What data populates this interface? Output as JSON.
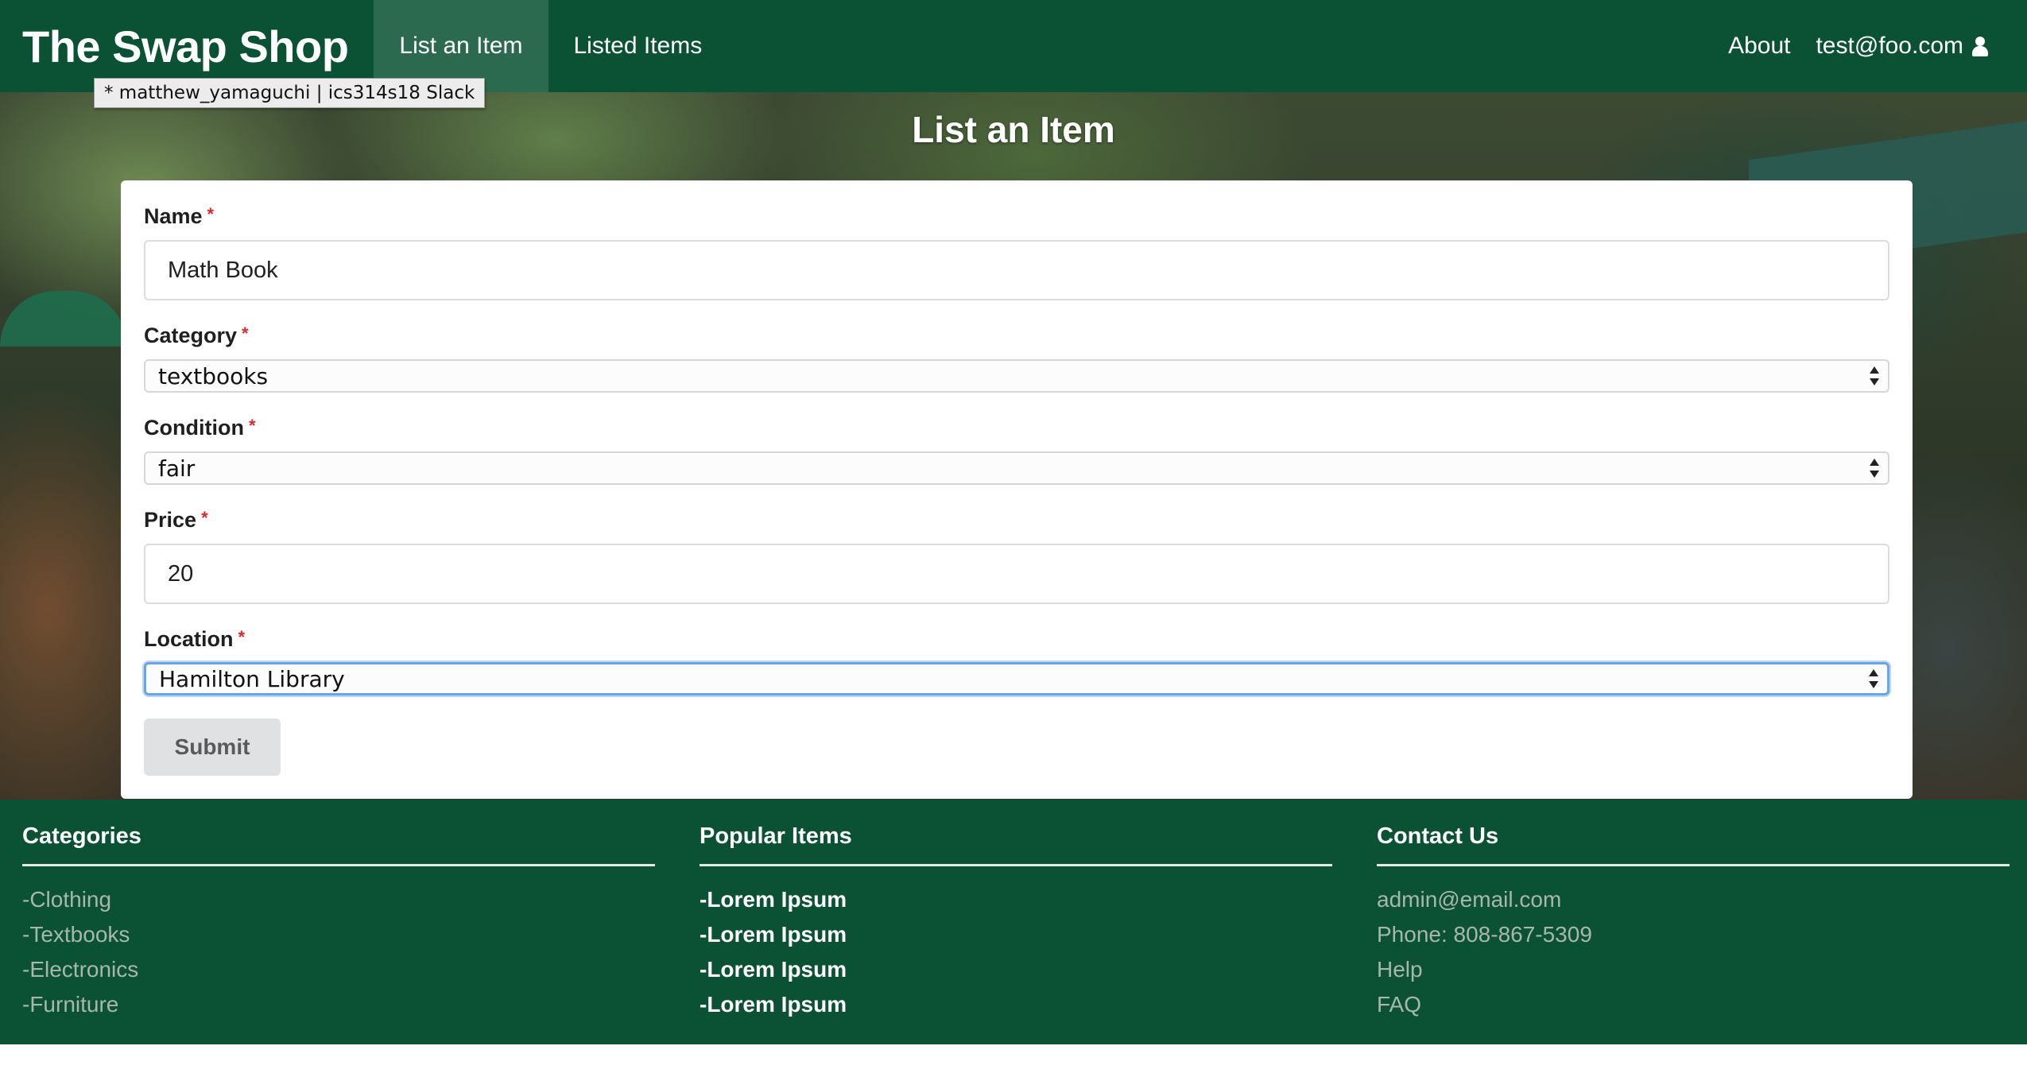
{
  "navbar": {
    "brand": "The Swap Shop",
    "items": [
      {
        "label": "List an Item",
        "active": true
      },
      {
        "label": "Listed Items",
        "active": false
      }
    ],
    "right": {
      "about": "About",
      "user": "test@foo.com",
      "user_icon": "user-icon"
    }
  },
  "tooltip": {
    "text": "* matthew_yamaguchi | ics314s18 Slack"
  },
  "page": {
    "title": "List an Item"
  },
  "form": {
    "required_marker": "*",
    "name": {
      "label": "Name",
      "value": "Math Book"
    },
    "category": {
      "label": "Category",
      "value": "textbooks"
    },
    "condition": {
      "label": "Condition",
      "value": "fair"
    },
    "price": {
      "label": "Price",
      "value": "20"
    },
    "location": {
      "label": "Location",
      "value": "Hamilton Library"
    },
    "submit_label": "Submit"
  },
  "footer": {
    "categories": {
      "heading": "Categories",
      "items": [
        "-Clothing",
        "-Textbooks",
        "-Electronics",
        "-Furniture"
      ]
    },
    "popular": {
      "heading": "Popular Items",
      "items": [
        "-Lorem Ipsum",
        "-Lorem Ipsum",
        "-Lorem Ipsum",
        "-Lorem Ipsum"
      ]
    },
    "contact": {
      "heading": "Contact Us",
      "items": [
        "admin@email.com",
        "Phone: 808-867-5309",
        "Help",
        "FAQ"
      ]
    }
  },
  "colors": {
    "brand_green": "#0a5233",
    "active_nav": "#2b6a4f",
    "required": "#db2828",
    "focus": "#6aa4e8"
  }
}
